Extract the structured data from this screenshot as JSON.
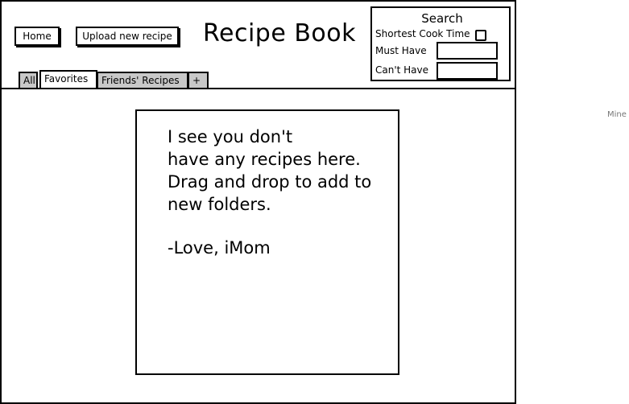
{
  "header": {
    "home_label": "Home",
    "upload_label": "Upload new recipe",
    "title": "Recipe Book"
  },
  "search": {
    "title": "Search",
    "shortest_cook_time_label": "Shortest Cook Time",
    "shortest_cook_time_checked": false,
    "must_have_label": "Must Have",
    "must_have_value": "",
    "cant_have_label": "Can't Have",
    "cant_have_value": ""
  },
  "tabs": [
    {
      "label": "All"
    },
    {
      "label": "Favorites",
      "active": true
    },
    {
      "label": "Friends' Recipes"
    },
    {
      "label": "+"
    }
  ],
  "note": {
    "message": "I see you don't\nhave any recipes here.\nDrag and drop to add to\nnew folders.",
    "signature": "-Love, iMom"
  },
  "side_label": "Mine"
}
